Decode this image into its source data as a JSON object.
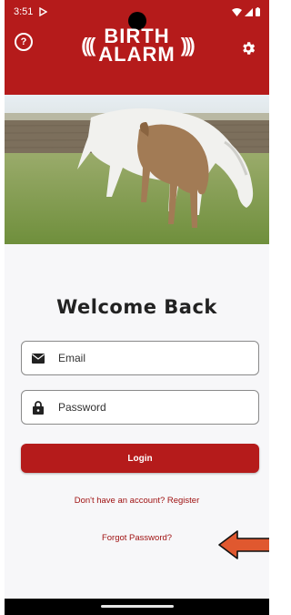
{
  "status_bar": {
    "time": "3:51"
  },
  "header": {
    "logo_line1": "BIRTH",
    "logo_line2": "ALARM",
    "logo_wave_left": "(((",
    "logo_wave_right": ")))",
    "help_glyph": "?",
    "help_icon": "question-circle-icon",
    "settings_icon": "gear-icon",
    "brand_color": "#b51b1b"
  },
  "hero": {
    "subject": "horses grazing"
  },
  "login": {
    "title": "Welcome Back",
    "email_placeholder": "Email",
    "password_placeholder": "Password",
    "login_label": "Login",
    "register_link": "Don't have an account? Register",
    "forgot_link": "Forgot Password?",
    "accent_color": "#b51b1b",
    "link_color": "#a01414"
  },
  "annotation": {
    "arrow_color": "#e0582f"
  }
}
